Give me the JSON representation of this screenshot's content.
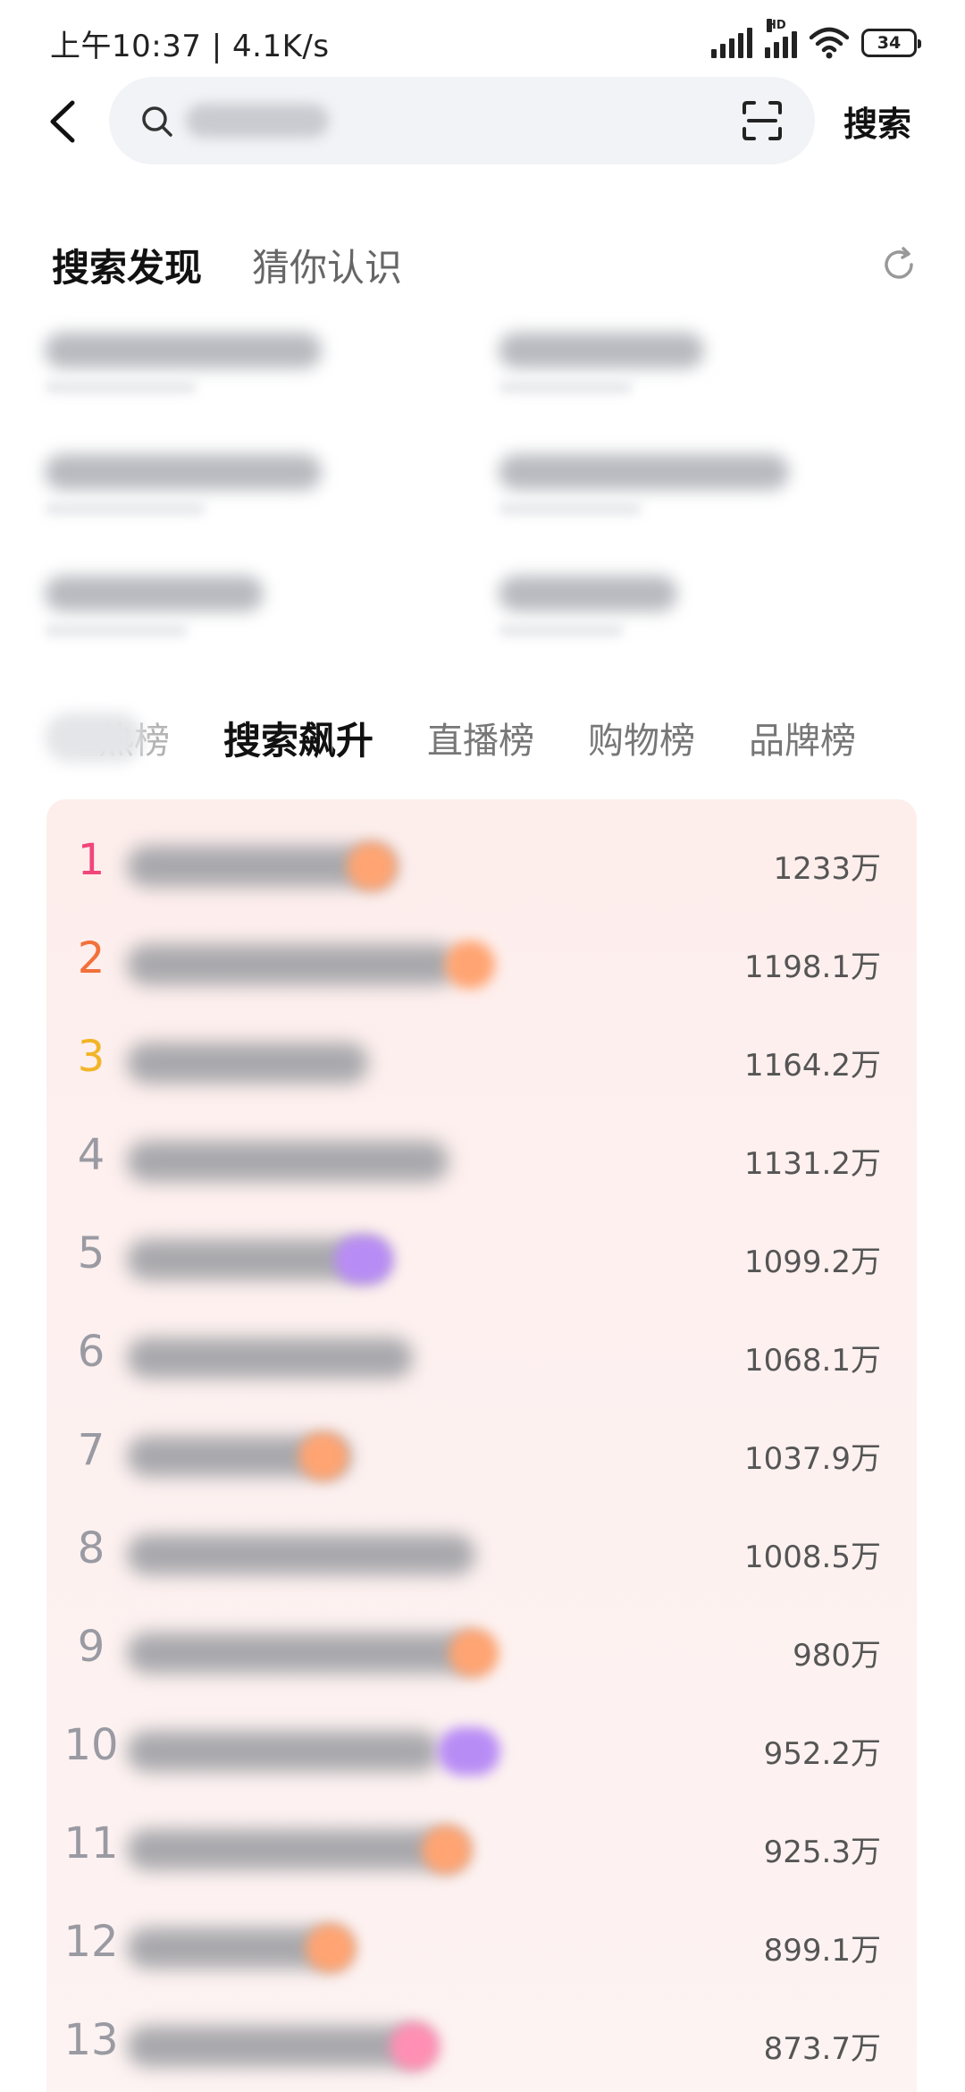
{
  "status_bar": {
    "time": "上午10:37 | 4.1K/s",
    "network_label": "HD",
    "battery": "34"
  },
  "search": {
    "placeholder": "",
    "button_label": "搜索"
  },
  "discover": {
    "tabs": [
      "搜索发现",
      "猜你认识"
    ]
  },
  "ranking": {
    "tabs": [
      "热榜",
      "搜索飙升",
      "直播榜",
      "购物榜",
      "品牌榜"
    ],
    "active_tab": "搜索飙升",
    "items": [
      {
        "rank": "1",
        "value": "1233万"
      },
      {
        "rank": "2",
        "value": "1198.1万"
      },
      {
        "rank": "3",
        "value": "1164.2万"
      },
      {
        "rank": "4",
        "value": "1131.2万"
      },
      {
        "rank": "5",
        "value": "1099.2万"
      },
      {
        "rank": "6",
        "value": "1068.1万"
      },
      {
        "rank": "7",
        "value": "1037.9万"
      },
      {
        "rank": "8",
        "value": "1008.5万"
      },
      {
        "rank": "9",
        "value": "980万"
      },
      {
        "rank": "10",
        "value": "952.2万"
      },
      {
        "rank": "11",
        "value": "925.3万"
      },
      {
        "rank": "12",
        "value": "899.1万"
      },
      {
        "rank": "13",
        "value": "873.7万"
      }
    ]
  },
  "colors": {
    "rank1": "#f0467a",
    "rank2": "#f2703a",
    "rank3": "#f2b427",
    "tag_orange": "#ffa472",
    "tag_purple": "#b88cf5",
    "tag_pink": "#ff8fb4"
  }
}
